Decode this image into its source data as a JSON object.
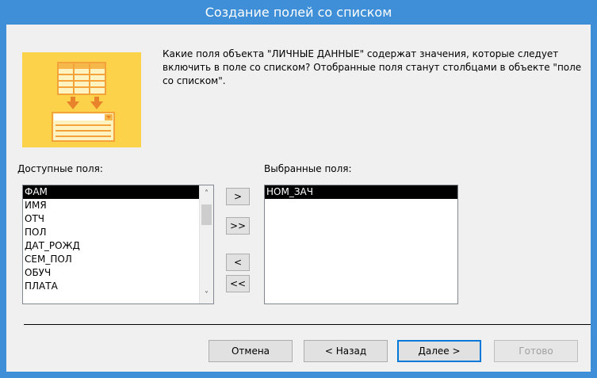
{
  "window": {
    "title": "Создание полей со списком"
  },
  "description": "Какие поля объекта \"ЛИЧНЫЕ ДАННЫЕ\" содержат значения, которые следует включить в поле со списком? Отобранные поля станут столбцами в объекте \"поле со списком\".",
  "available": {
    "label": "Доступные поля:",
    "items": [
      "ФАМ",
      "ИМЯ",
      "ОТЧ",
      "ПОЛ",
      "ДАТ_РОЖД",
      "СЕМ_ПОЛ",
      "ОБУЧ",
      "ПЛАТА"
    ],
    "selected_index": 0
  },
  "selected": {
    "label": "Выбранные поля:",
    "items": [
      "НОМ_ЗАЧ"
    ]
  },
  "move_buttons": {
    "add_one": ">",
    "add_all": ">>",
    "remove_one": "<",
    "remove_all": "<<"
  },
  "footer": {
    "cancel": "Отмена",
    "back": "< Назад",
    "next": "Далее >",
    "finish": "Готово"
  },
  "colors": {
    "titlebar": "#3f8fd8",
    "wizard_art": "#fbd24a",
    "selection": "#000000"
  }
}
